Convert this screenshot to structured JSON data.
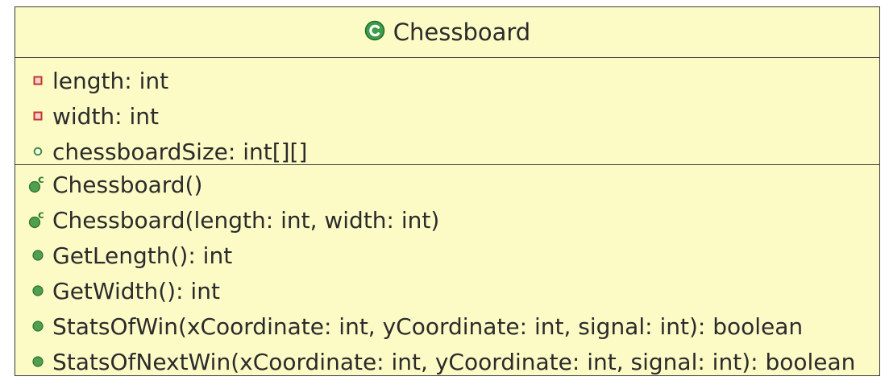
{
  "class": {
    "name": "Chessboard",
    "icon": "class-icon",
    "colors": {
      "background": "#fcfbc6",
      "border": "#3a3a3a",
      "private": "#c0392b",
      "public": "#3f8f3f"
    }
  },
  "fields": [
    {
      "text": "length: int",
      "icon": "private-field-icon"
    },
    {
      "text": "width: int",
      "icon": "private-field-icon"
    },
    {
      "text": "chessboardSize: int[][]",
      "icon": "package-field-icon"
    }
  ],
  "methods": [
    {
      "text": "Chessboard()",
      "icon": "constructor-icon"
    },
    {
      "text": "Chessboard(length: int, width: int)",
      "icon": "constructor-icon"
    },
    {
      "text": "GetLength(): int",
      "icon": "public-method-icon"
    },
    {
      "text": "GetWidth(): int",
      "icon": "public-method-icon"
    },
    {
      "text": "StatsOfWin(xCoordinate: int, yCoordinate: int, signal: int): boolean",
      "icon": "public-method-icon"
    },
    {
      "text": "StatsOfNextWin(xCoordinate: int, yCoordinate: int, signal: int): boolean",
      "icon": "public-method-icon"
    }
  ]
}
